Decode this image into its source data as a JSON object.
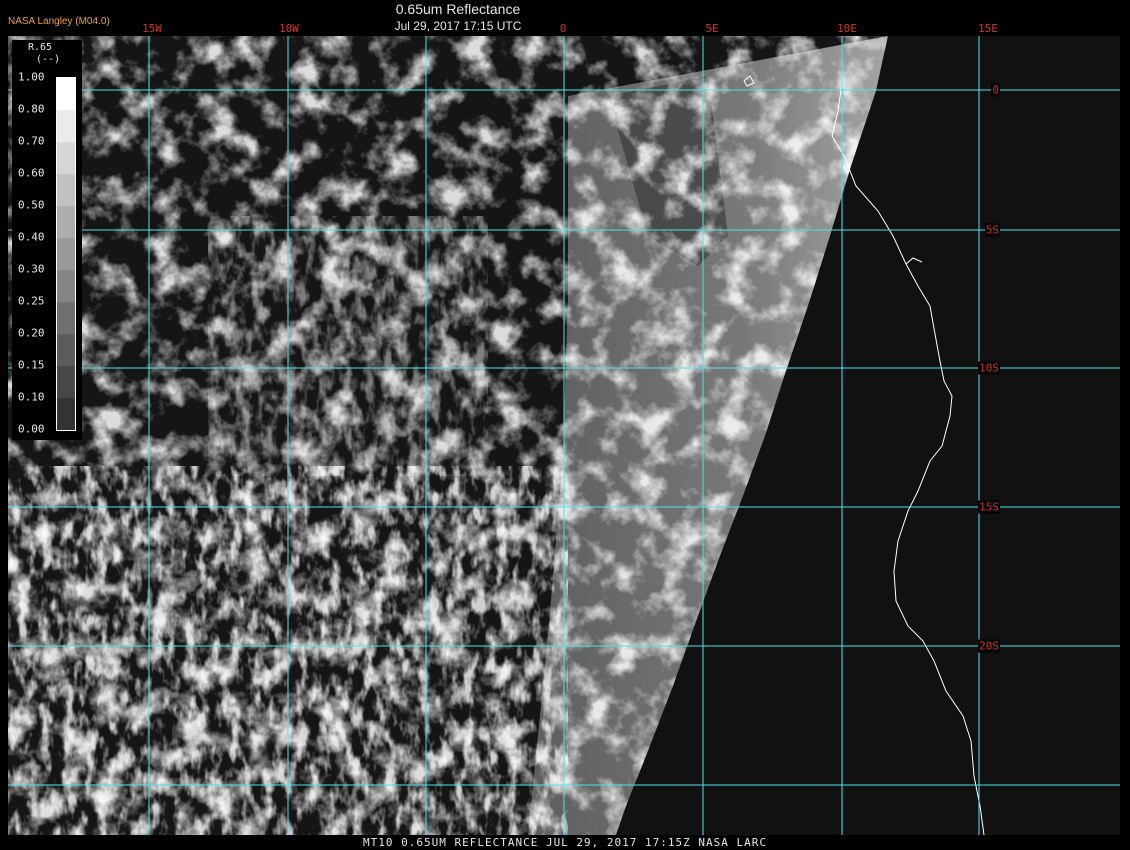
{
  "credit": "NASA Langley (M04.0)",
  "title": "0.65um Reflectance",
  "timestamp": "Jul 29, 2017 17:15 UTC",
  "lon_labels": [
    "15W",
    "10W",
    "0",
    "5E",
    "10E",
    "15E"
  ],
  "lat_labels": [
    "0",
    "5S",
    "10S",
    "15S",
    "20S"
  ],
  "legend": {
    "title": "R.65",
    "unit": "(--)",
    "ticks": [
      "1.00",
      "0.80",
      "0.70",
      "0.60",
      "0.50",
      "0.40",
      "0.30",
      "0.25",
      "0.20",
      "0.15",
      "0.10",
      "0.00"
    ],
    "colors": [
      "#ffffff",
      "#ebebeb",
      "#d6d6d6",
      "#c2c2c2",
      "#adadad",
      "#999999",
      "#858585",
      "#707070",
      "#5c5c5c",
      "#474747",
      "#333333"
    ]
  },
  "footer": "MT10  0.65UM REFLECTANCE   JUL 29, 2017 17:15Z   NASA LARC",
  "colors": {
    "grid": "#4fe3ea",
    "coast": "#ffffff",
    "label": "#d0362c",
    "credit": "#e8a23a"
  }
}
